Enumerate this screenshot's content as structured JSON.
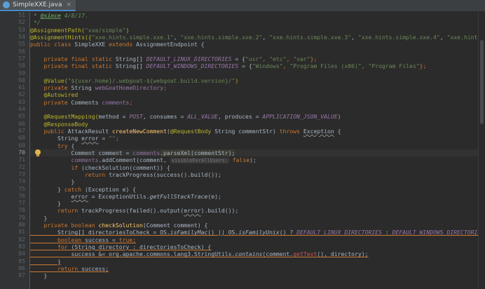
{
  "tab": {
    "label": "SimpleXXE.java"
  },
  "gutter": {
    "lines": [
      "51",
      "52",
      "53",
      "54",
      "55",
      "56",
      "57",
      "58",
      "59",
      "60",
      "61",
      "62",
      "63",
      "64",
      "65",
      "66",
      "67",
      "68",
      "69",
      "70",
      "71",
      "72",
      "73",
      "74",
      "75",
      "76",
      "77",
      "78",
      "79",
      "80",
      "81",
      "82",
      "83",
      "84",
      "85",
      "86",
      "87"
    ],
    "current": "70"
  },
  "code": {
    "l51": {
      "a": " * ",
      "b": "@since",
      "c": " 4/8/17."
    },
    "l52": " */",
    "l53": {
      "a": "@AssignmentPath(",
      "b": "\"xxe/simple\"",
      "c": ")"
    },
    "l54": {
      "a": "@AssignmentHints({",
      "b": "\"xxe.hints.simple.xxe.1\"",
      "c": ", ",
      "d": "\"xxe.hints.simple.xxe.2\"",
      "e": ", ",
      "f": "\"xxe.hints.simple.xxe.3\"",
      "g": ", ",
      "h": "\"xxe.hints.simple.xxe.4\"",
      "i": ", ",
      "j": "\"xxe.hints.sim"
    },
    "l55": {
      "a": "public class ",
      "b": "SimpleXXE ",
      "c": "extends ",
      "d": "AssignmentEndpoint {"
    },
    "l57": {
      "a": "private final static ",
      "b": "String[] ",
      "c": "DEFAULT_LINUX_DIRECTORIES",
      "d": " = {",
      "e": "\"usr\"",
      "f": ", ",
      "g": "\"etc\"",
      "h": ", ",
      "i": "\"var\"",
      "j": "};"
    },
    "l58": {
      "a": "private final static ",
      "b": "String[] ",
      "c": "DEFAULT_WINDOWS_DIRECTORIES",
      "d": " = {",
      "e": "\"Windows\"",
      "f": ", ",
      "g": "\"Program Files (x86)\"",
      "h": ", ",
      "i": "\"Program Files\"",
      "j": "};"
    },
    "l60": {
      "a": "@Value(",
      "b": "\"${user.home}/.webgoat-${webgoat.build.version}/\"",
      "c": ")"
    },
    "l61": {
      "a": "private ",
      "b": "String ",
      "c": "webGoatHomeDirectory",
      "d": ";"
    },
    "l62": "@Autowired",
    "l63": {
      "a": "private ",
      "b": "Comments ",
      "c": "comments",
      "d": ";"
    },
    "l65": {
      "a": "@RequestMapping(",
      "b": "method",
      "c": " = ",
      "d": "POST",
      "e": ", ",
      "f": "consumes",
      "g": " = ",
      "h": "ALL_VALUE",
      "i": ", ",
      "j": "produces",
      "k": " = ",
      "l": "APPLICATION_JSON_VALUE",
      "m": ")"
    },
    "l66": "@ResponseBody",
    "l67": {
      "a": "public ",
      "b": "AttackResult ",
      "c": "createNewComment",
      "d": "(",
      "e": "@RequestBody ",
      "f": "String commentStr) ",
      "g": "throws ",
      "h": "Exception",
      "i": " {"
    },
    "l68": {
      "a": "String ",
      "b": "error",
      "c": " = ",
      "d": "\"\"",
      "e": ";"
    },
    "l69": {
      "a": "try ",
      "b": "{"
    },
    "l70": {
      "a": "Comment comment = ",
      "b": "comments",
      "c": ".parseXml(commentStr);"
    },
    "l71": {
      "a": "comments",
      "b": ".addComment(comment, ",
      "c": "visibleForAllUsers:",
      "d": " false",
      "e": ");"
    },
    "l72": {
      "a": "if ",
      "b": "(checkSolution(comment)) {"
    },
    "l73": {
      "a": "return ",
      "b": "trackProgress(success().build());"
    },
    "l74": "}",
    "l75": {
      "a": "} ",
      "b": "catch ",
      "c": "(Exception e) {"
    },
    "l76": {
      "a": "error",
      "b": " = ExceptionUtils.",
      "c": "getFullStackTrace",
      "d": "(e);"
    },
    "l77": "}",
    "l78": {
      "a": "return ",
      "b": "trackProgress(failed().output(",
      "c": "error",
      "d": ").build());"
    },
    "l79": "}",
    "l80": {
      "a": "private boolean ",
      "b": "checkSolution",
      "c": "(Comment comment) {"
    },
    "l81": {
      "a": "String[] directoriesToCheck = OS.",
      "b": "isFamilyMac",
      "c": "() || OS.",
      "d": "isFamilyUnix",
      "e": "() ? ",
      "f": "DEFAULT_LINUX_DIRECTORIES",
      "g": " : ",
      "h": "DEFAULT_WINDOWS_DIRECTORIES",
      "i": ";"
    },
    "l82": {
      "a": "boolean ",
      "b": "success = ",
      "c": "true",
      "d": ";"
    },
    "l83": {
      "a": "for ",
      "b": "(String directory : directoriesToCheck) {"
    },
    "l84": {
      "a": "success &= org.apache.commons.lang3.StringUtils.",
      "b": "contains",
      "c": "(comment.",
      "d": "getText",
      "e": "(), directory);"
    },
    "l85": "}",
    "l86": {
      "a": "return ",
      "b": "success;"
    },
    "l87": "}"
  }
}
